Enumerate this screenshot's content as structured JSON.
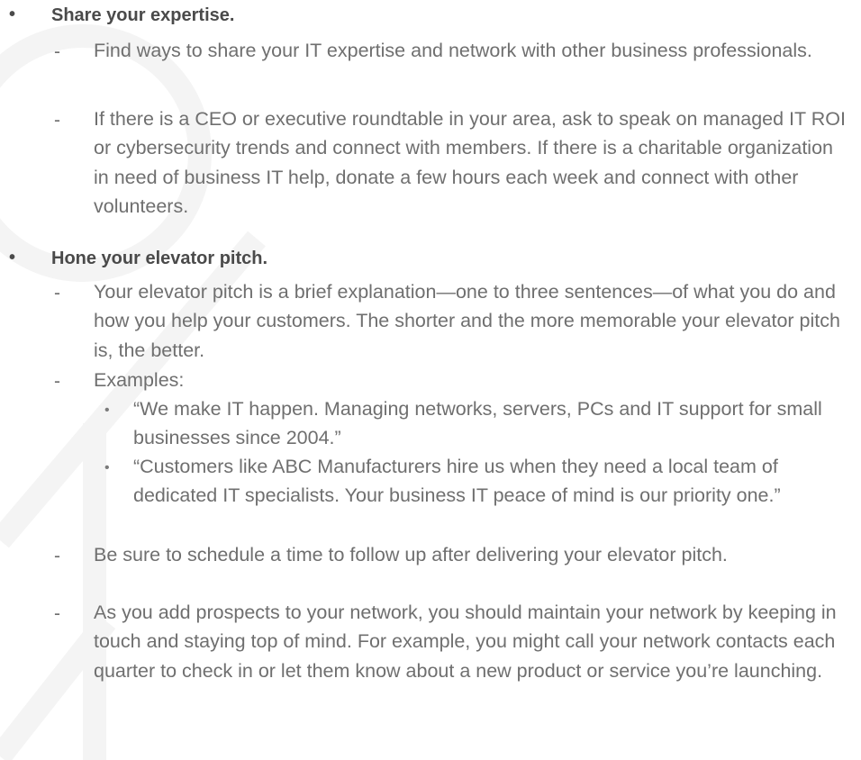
{
  "sections": [
    {
      "heading": "Share your expertise.",
      "items": [
        "Find ways to share your IT expertise and network with other business professionals.",
        "If there is a CEO or executive roundtable in your area, ask to speak on managed IT ROI or cybersecurity trends and connect with members. If there is a charitable organization in need of business IT help, donate a few hours each week and connect with other volunteers."
      ]
    },
    {
      "heading": "Hone your elevator pitch.",
      "items": [
        "Your elevator pitch is a brief explanation—one to three sentences—of what you do and how you help your customers. The shorter and the more memorable your elevator pitch is, the better.",
        "Examples:",
        "Be sure to schedule a time to follow up after delivering your elevator pitch.",
        "As you add prospects to your network, you should maintain your network by keeping in touch and staying top of mind. For example, you might call your network contacts each quarter to check in or let them know about a new product or service you’re launching."
      ],
      "examples": [
        "“We make IT happen. Managing networks, servers, PCs and IT support for small businesses since 2004.”",
        "“Customers like ABC Manufacturers hire us when they need a local team of dedicated IT specialists. Your business IT peace of mind is our priority one.”"
      ]
    }
  ]
}
